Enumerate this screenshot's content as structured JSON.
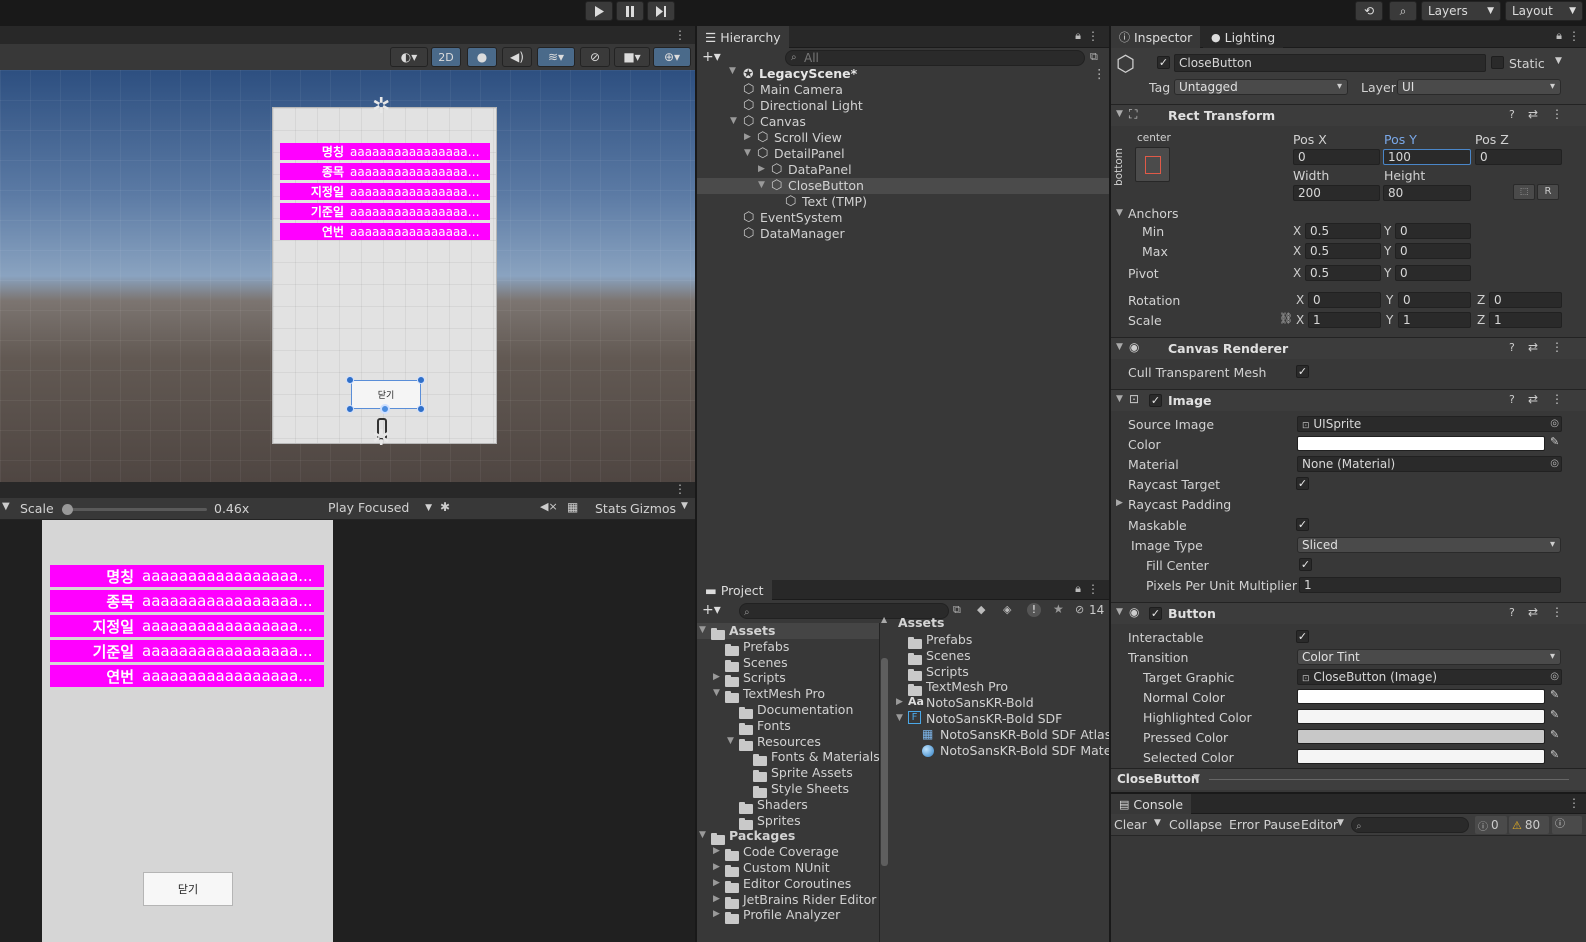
{
  "toolbar": {
    "play_icon": "play-icon",
    "pause_icon": "pause-icon",
    "step_icon": "step-icon",
    "layers_label": "Layers",
    "layout_label": "Layout"
  },
  "scene": {
    "mode_2d": "2D",
    "canvas_rows": [
      {
        "key": "명칭",
        "value": "aaaaaaaaaaaaaaaaa..."
      },
      {
        "key": "종목",
        "value": "aaaaaaaaaaaaaaaaa..."
      },
      {
        "key": "지정일",
        "value": "aaaaaaaaaaaaaaaaa..."
      },
      {
        "key": "기준일",
        "value": "aaaaaaaaaaaaaaaaa..."
      },
      {
        "key": "연번",
        "value": "aaaaaaaaaaaaaaaaa..."
      }
    ],
    "close_label": "닫기"
  },
  "game": {
    "scale_label": "Scale",
    "scale_value": "0.46x",
    "scale_fraction": 0.0,
    "play_focused": "Play Focused",
    "stats": "Stats",
    "gizmos": "Gizmos",
    "rows": [
      {
        "key": "명칭",
        "value": "aaaaaaaaaaaaaaaaa..."
      },
      {
        "key": "종목",
        "value": "aaaaaaaaaaaaaaaaa..."
      },
      {
        "key": "지정일",
        "value": "aaaaaaaaaaaaaaaaa..."
      },
      {
        "key": "기준일",
        "value": "aaaaaaaaaaaaaaaaa..."
      },
      {
        "key": "연번",
        "value": "aaaaaaaaaaaaaaaaa..."
      }
    ],
    "close_label": "닫기"
  },
  "hierarchy": {
    "tab": "Hierarchy",
    "search_placeholder": "All",
    "scene_name": "LegacyScene*",
    "items": [
      {
        "label": "Main Camera"
      },
      {
        "label": "Directional Light"
      },
      {
        "label": "Canvas"
      },
      {
        "label": "Scroll View"
      },
      {
        "label": "DetailPanel"
      },
      {
        "label": "DataPanel"
      },
      {
        "label": "CloseButton"
      },
      {
        "label": "Text (TMP)"
      },
      {
        "label": "EventSystem"
      },
      {
        "label": "DataManager"
      }
    ]
  },
  "project": {
    "tab": "Project",
    "hidden_count": "14",
    "tree": [
      {
        "label": "Assets"
      },
      {
        "label": "Prefabs"
      },
      {
        "label": "Scenes"
      },
      {
        "label": "Scripts"
      },
      {
        "label": "TextMesh Pro"
      },
      {
        "label": "Documentation"
      },
      {
        "label": "Fonts"
      },
      {
        "label": "Resources"
      },
      {
        "label": "Fonts & Materials"
      },
      {
        "label": "Sprite Assets"
      },
      {
        "label": "Style Sheets"
      },
      {
        "label": "Shaders"
      },
      {
        "label": "Sprites"
      },
      {
        "label": "Packages"
      },
      {
        "label": "Code Coverage"
      },
      {
        "label": "Custom NUnit"
      },
      {
        "label": "Editor Coroutines"
      },
      {
        "label": "JetBrains Rider Editor"
      },
      {
        "label": "Profile Analyzer"
      }
    ],
    "breadcrumb": "Assets",
    "files": [
      {
        "label": "Prefabs"
      },
      {
        "label": "Scenes"
      },
      {
        "label": "Scripts"
      },
      {
        "label": "TextMesh Pro"
      },
      {
        "label": "NotoSansKR-Bold"
      },
      {
        "label": "NotoSansKR-Bold SDF"
      },
      {
        "label": "NotoSansKR-Bold SDF Atlas"
      },
      {
        "label": "NotoSansKR-Bold SDF Material"
      }
    ]
  },
  "inspector": {
    "tab": "Inspector",
    "lighting_tab": "Lighting",
    "object_name": "CloseButton",
    "static_label": "Static",
    "tag_label": "Tag",
    "tag_value": "Untagged",
    "layer_label": "Layer",
    "layer_value": "UI",
    "rect": {
      "title": "Rect Transform",
      "anchor_h": "center",
      "anchor_v": "bottom",
      "posx_label": "Pos X",
      "posx": "0",
      "posy_label": "Pos Y",
      "posy": "100",
      "posz_label": "Pos Z",
      "posz": "0",
      "width_label": "Width",
      "width": "200",
      "height_label": "Height",
      "height": "80",
      "anchors_label": "Anchors",
      "min_label": "Min",
      "min_x": "0.5",
      "min_y": "0",
      "max_label": "Max",
      "max_x": "0.5",
      "max_y": "0",
      "pivot_label": "Pivot",
      "pivot_x": "0.5",
      "pivot_y": "0",
      "rotation_label": "Rotation",
      "rot_x": "0",
      "rot_y": "0",
      "rot_z": "0",
      "scale_label": "Scale",
      "scale_x": "1",
      "scale_y": "1",
      "scale_z": "1",
      "x": "X",
      "y": "Y",
      "z": "Z",
      "r_btn": "R"
    },
    "canvas_renderer": {
      "title": "Canvas Renderer",
      "cull_label": "Cull Transparent Mesh"
    },
    "image": {
      "title": "Image",
      "source_label": "Source Image",
      "source_value": "UISprite",
      "color_label": "Color",
      "material_label": "Material",
      "material_value": "None (Material)",
      "raycast_label": "Raycast Target",
      "raycast_padding_label": "Raycast Padding",
      "maskable_label": "Maskable",
      "type_label": "Image Type",
      "type_value": "Sliced",
      "fill_label": "Fill Center",
      "ppu_label": "Pixels Per Unit Multiplier",
      "ppu_value": "1"
    },
    "button": {
      "title": "Button",
      "interactable_label": "Interactable",
      "transition_label": "Transition",
      "transition_value": "Color Tint",
      "target_label": "Target Graphic",
      "target_value": "CloseButton (Image)",
      "normal_label": "Normal Color",
      "highlighted_label": "Highlighted Color",
      "pressed_label": "Pressed Color",
      "selected_label": "Selected Color"
    },
    "footer_object": "CloseButton"
  },
  "console": {
    "tab": "Console",
    "clear": "Clear",
    "collapse": "Collapse",
    "error_pause": "Error Pause",
    "editor": "Editor",
    "info_count": "0",
    "warn_count": "80"
  },
  "colors": {
    "accent": "#ff00ff",
    "selection": "#2c5d87",
    "editor_bg": "#383838"
  }
}
